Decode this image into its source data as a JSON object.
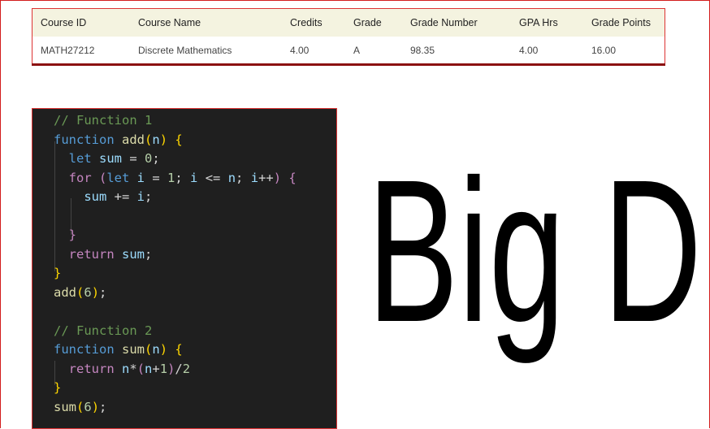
{
  "table": {
    "headers": [
      "Course ID",
      "Course Name",
      "Credits",
      "Grade",
      "Grade Number",
      "GPA Hrs",
      "Grade Points"
    ],
    "rows": [
      [
        "MATH27212",
        "Discrete Mathematics",
        "4.00",
        "A",
        "98.35",
        "4.00",
        "16.00"
      ]
    ]
  },
  "code": {
    "lines": [
      [
        [
          "// Function 1",
          "c"
        ]
      ],
      [
        [
          "function ",
          "k"
        ],
        [
          "add",
          "f"
        ],
        [
          "(",
          "y"
        ],
        [
          "n",
          "v"
        ],
        [
          ")",
          "y"
        ],
        [
          " {",
          "y"
        ]
      ],
      [
        [
          "  let ",
          "k"
        ],
        [
          "sum",
          "v"
        ],
        [
          " = ",
          "o"
        ],
        [
          "0",
          "n"
        ],
        [
          ";",
          "o"
        ]
      ],
      [
        [
          "  for ",
          "p"
        ],
        [
          "(",
          "p"
        ],
        [
          "let ",
          "k"
        ],
        [
          "i",
          "v"
        ],
        [
          " = ",
          "o"
        ],
        [
          "1",
          "n"
        ],
        [
          "; ",
          "o"
        ],
        [
          "i",
          "v"
        ],
        [
          " <= ",
          "o"
        ],
        [
          "n",
          "v"
        ],
        [
          "; ",
          "o"
        ],
        [
          "i",
          "v"
        ],
        [
          "++",
          "o"
        ],
        [
          ") {",
          "p"
        ]
      ],
      [
        [
          "    sum",
          "v"
        ],
        [
          " += ",
          "o"
        ],
        [
          "i",
          "v"
        ],
        [
          ";",
          "o"
        ]
      ],
      [
        [
          "",
          ""
        ]
      ],
      [
        [
          "  }",
          "p"
        ]
      ],
      [
        [
          "  return ",
          "p"
        ],
        [
          "sum",
          "v"
        ],
        [
          ";",
          "o"
        ]
      ],
      [
        [
          "}",
          "y"
        ]
      ],
      [
        [
          "add",
          "f"
        ],
        [
          "(",
          "y"
        ],
        [
          "6",
          "n"
        ],
        [
          ")",
          "y"
        ],
        [
          ";",
          "o"
        ]
      ],
      [
        [
          "",
          ""
        ]
      ],
      [
        [
          "// Function 2",
          "c"
        ]
      ],
      [
        [
          "function ",
          "k"
        ],
        [
          "sum",
          "f"
        ],
        [
          "(",
          "y"
        ],
        [
          "n",
          "v"
        ],
        [
          ")",
          "y"
        ],
        [
          " {",
          "y"
        ]
      ],
      [
        [
          "  return ",
          "p"
        ],
        [
          "n",
          "v"
        ],
        [
          "*",
          "o"
        ],
        [
          "(",
          "p"
        ],
        [
          "n",
          "v"
        ],
        [
          "+",
          "o"
        ],
        [
          "1",
          "n"
        ],
        [
          ")",
          "p"
        ],
        [
          "/",
          "o"
        ],
        [
          "2",
          "n"
        ]
      ],
      [
        [
          "}",
          "y"
        ]
      ],
      [
        [
          "sum",
          "f"
        ],
        [
          "(",
          "y"
        ],
        [
          "6",
          "n"
        ],
        [
          ")",
          "y"
        ],
        [
          ";",
          "o"
        ]
      ]
    ]
  },
  "handwriting": "Big D"
}
